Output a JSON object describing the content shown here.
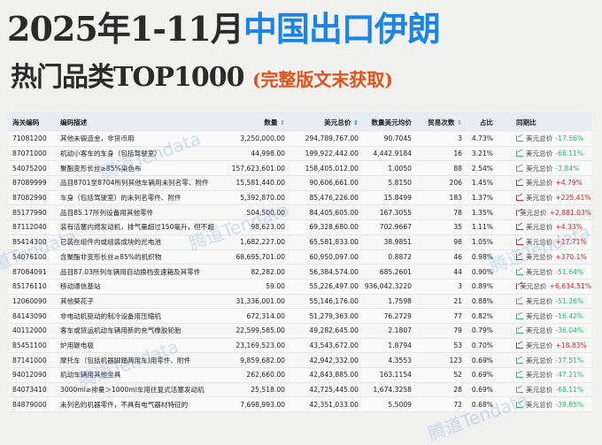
{
  "title": {
    "line1_prefix": "2025年1-11月",
    "line1_highlight": "中国出口伊朗",
    "line2": "热门品类TOP1000",
    "line2_note": "(完整版文末获取)"
  },
  "watermark": "腾道Tendata",
  "colors": {
    "accent": "#1a84e8",
    "up": "#e02020",
    "down": "#2dbb6e",
    "note": "#e8501a"
  },
  "table": {
    "headers": [
      "海关编码",
      "编码描述",
      "数量",
      "美元总价",
      "数量美元均价",
      "贸易次数",
      "占比",
      "同期比"
    ],
    "yoy_label": "美元总价",
    "rows": [
      [
        "71081200",
        "其他未锻造金，非货币用",
        "3,250,000.00",
        "294,789,767.00",
        "90.7045",
        "3",
        "4.73%",
        "-17.56%",
        "down"
      ],
      [
        "87071000",
        "机动小客车的车身（包括驾驶室）",
        "44,998.00",
        "199,922,442.00",
        "4,442.9184",
        "16",
        "3.21%",
        "-66.11%",
        "down"
      ],
      [
        "54075200",
        "聚酯变形长丝≥85%染色布",
        "157,623,601.00",
        "158,405,012.00",
        "1.0050",
        "88",
        "2.54%",
        "-3.84%",
        "down"
      ],
      [
        "87089999",
        "品目8701至8704所列其他车辆用未列名零、附件",
        "15,581,440.00",
        "90,606,661.00",
        "5.8150",
        "206",
        "1.45%",
        "+4.79%",
        "up"
      ],
      [
        "87082990",
        "车身（包括驾驶室）的未列名零件、附件",
        "5,392,870.00",
        "85,476,226.00",
        "15.8499",
        "183",
        "1.37%",
        "+225.41%",
        "up"
      ],
      [
        "85177990",
        "品目85.17所列设备用其他零件",
        "504,500.00",
        "84,405,605.00",
        "167.3055",
        "78",
        "1.35%",
        "+2,881.03%",
        "up"
      ],
      [
        "87112040",
        "装有活塞内燃发动机，排气量超过150毫升，但不超...",
        "98,623.00",
        "69,328,680.00",
        "702.9667",
        "35",
        "1.11%",
        "+4.33%",
        "up"
      ],
      [
        "85414300",
        "已装在组件内或组装成块的光电池",
        "1,682,227.00",
        "65,581,833.00",
        "38.9851",
        "98",
        "1.05%",
        "+17.71%",
        "up"
      ],
      [
        "54076100",
        "含聚酯非变形长丝≥85%的机织物",
        "68,695,701.00",
        "60,950,097.00",
        "0.8872",
        "46",
        "0.98%",
        "+370.1%",
        "up"
      ],
      [
        "87084091",
        "品目87.03所列车辆用自动换档变速箱及其零件",
        "82,282.00",
        "56,384,574.00",
        "685.2601",
        "44",
        "0.90%",
        "-51.64%",
        "down"
      ],
      [
        "85176110",
        "移动通信基站",
        "59.00",
        "55,226,497.00",
        "936,042.3220",
        "3",
        "0.89%",
        "+6,634.51%",
        "up"
      ],
      [
        "12060090",
        "其他葵花子",
        "31,336,001.00",
        "55,146,176.00",
        "1.7598",
        "21",
        "0.88%",
        "-51.26%",
        "down"
      ],
      [
        "84143090",
        "非电动机驱动的制冷设备用压缩机",
        "672,314.00",
        "51,279,363.00",
        "76.2729",
        "77",
        "0.82%",
        "-16.42%",
        "down"
      ],
      [
        "40112000",
        "客车或货运机动车辆用新的充气橡胶轮胎",
        "22,599,585.00",
        "49,282,645.00",
        "2.1807",
        "79",
        "0.79%",
        "-36.04%",
        "down"
      ],
      [
        "85451100",
        "炉用碳电极",
        "23,169,523.00",
        "43,543,672.00",
        "1.8794",
        "53",
        "0.70%",
        "+18.83%",
        "up"
      ],
      [
        "87141000",
        "摩托车（包括机器脚踏两用车)用零件、附件",
        "9,859,682.00",
        "42,942,332.00",
        "4.3553",
        "123",
        "0.69%",
        "-37.51%",
        "down"
      ],
      [
        "94012090",
        "机动车辆用其他坐具",
        "262,660.00",
        "42,843,885.00",
        "163.1154",
        "52",
        "0.69%",
        "-47.21%",
        "down"
      ],
      [
        "84073410",
        "3000ml≥排量＞1000ml车用往复式活塞发动机",
        "25,518.00",
        "42,725,445.00",
        "1,674.3258",
        "28",
        "0.69%",
        "-68.11%",
        "down"
      ],
      [
        "84879000",
        "未列名的机器零件，不具有电气器材特征的",
        "7,698,993.00",
        "42,351,033.00",
        "5.5009",
        "72",
        "0.68%",
        "-39.85%",
        "down"
      ]
    ]
  }
}
